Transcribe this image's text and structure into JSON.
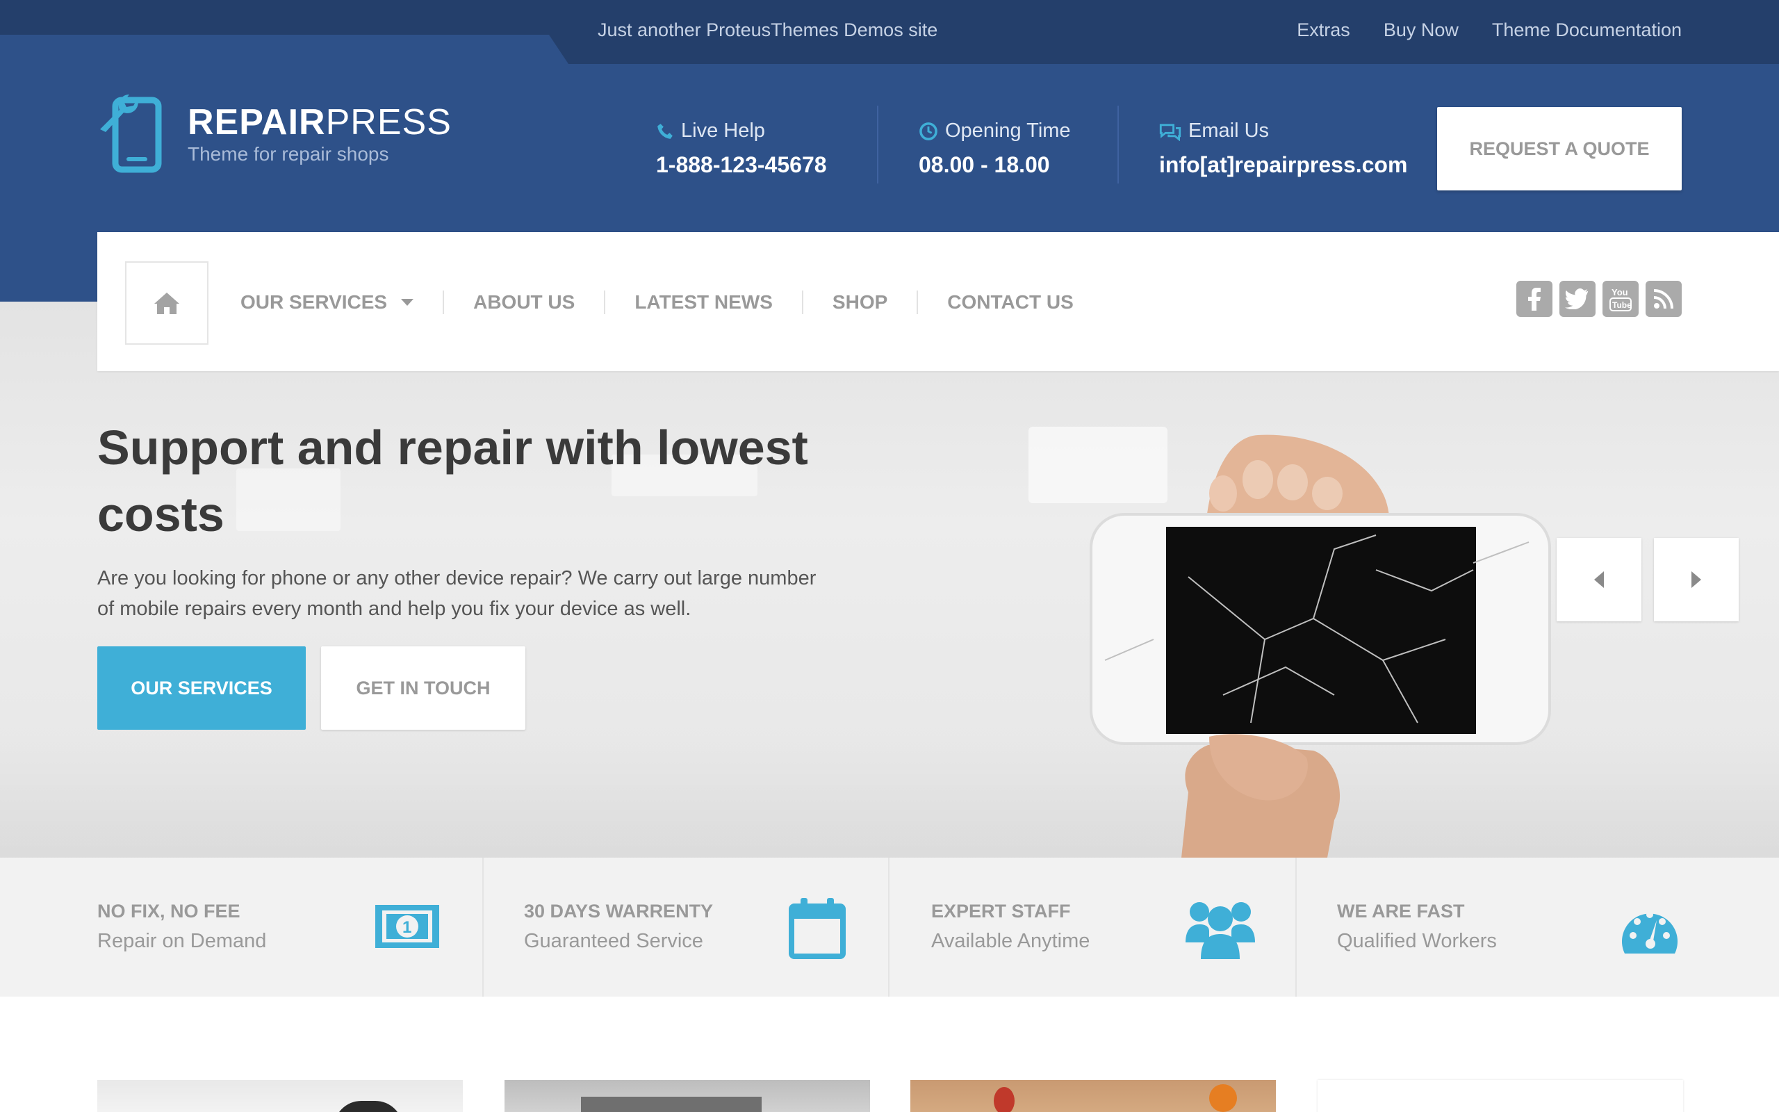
{
  "colors": {
    "primary_blue": "#2e5189",
    "dark_blue": "#243f6b",
    "accent": "#3fafd7",
    "muted": "#999999"
  },
  "topbar": {
    "tagline": "Just another ProteusThemes Demos site",
    "links": [
      "Extras",
      "Buy Now",
      "Theme Documentation"
    ]
  },
  "brand": {
    "name_bold": "REPAIR",
    "name_light": "PRESS",
    "tagline": "Theme for repair shops",
    "icon": "phone-wrench-icon"
  },
  "contacts": [
    {
      "icon": "phone-icon",
      "label": "Live Help",
      "value": "1-888-123-45678"
    },
    {
      "icon": "clock-icon",
      "label": "Opening Time",
      "value": "08.00 - 18.00"
    },
    {
      "icon": "chat-icon",
      "label": "Email Us",
      "value": "info[at]repairpress.com"
    }
  ],
  "header": {
    "quote_button": "REQUEST A QUOTE"
  },
  "nav": {
    "home_icon": "home-icon",
    "items": [
      "OUR SERVICES",
      "ABOUT US",
      "LATEST NEWS",
      "SHOP",
      "CONTACT US"
    ],
    "socials": [
      "facebook-icon",
      "twitter-icon",
      "youtube-icon",
      "rss-icon"
    ]
  },
  "hero": {
    "title": "Support and repair with lowest costs",
    "text": "Are you looking for phone or any other device repair? We carry out large number of mobile repairs every month and help you fix your device as well.",
    "primary_button": "OUR SERVICES",
    "secondary_button": "GET IN TOUCH"
  },
  "features": [
    {
      "title": "NO FIX, NO FEE",
      "subtitle": "Repair on Demand",
      "icon": "money-icon"
    },
    {
      "title": "30 DAYS WARRENTY",
      "subtitle": "Guaranteed Service",
      "icon": "calendar-icon"
    },
    {
      "title": "EXPERT STAFF",
      "subtitle": "Available Anytime",
      "icon": "users-icon"
    },
    {
      "title": "WE ARE FAST",
      "subtitle": "Qualified Workers",
      "icon": "speedometer-icon"
    }
  ]
}
